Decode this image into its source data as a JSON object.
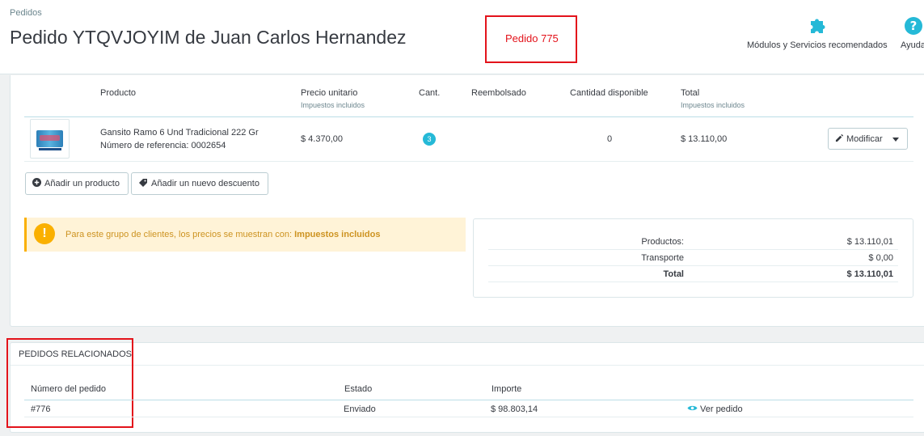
{
  "header": {
    "breadcrumb": "Pedidos",
    "title": "Pedido YTQVJOYIM de Juan Carlos Hernandez",
    "annotation": "Pedido 775",
    "actions": [
      {
        "label": "Módulos y Servicios recomendados",
        "icon": "puzzle-icon"
      },
      {
        "label": "Ayuda",
        "icon": "help-icon"
      }
    ]
  },
  "products_table": {
    "columns": [
      {
        "label": "Producto",
        "sub": ""
      },
      {
        "label": "Precio unitario",
        "sub": "Impuestos incluidos"
      },
      {
        "label": "Cant.",
        "sub": ""
      },
      {
        "label": "Reembolsado",
        "sub": ""
      },
      {
        "label": "Cantidad disponible",
        "sub": ""
      },
      {
        "label": "Total",
        "sub": "Impuestos incluidos"
      }
    ],
    "rows": [
      {
        "name": "Gansito Ramo 6 Und Tradicional 222 Gr",
        "reference": "Número de referencia: 0002654",
        "unit_price": "$ 4.370,00",
        "quantity": "3",
        "refunded": "",
        "available": "0",
        "total": "$ 13.110,00",
        "edit_label": "Modificar"
      }
    ]
  },
  "buttons": {
    "add_product": "Añadir un producto",
    "add_discount": "Añadir un nuevo descuento"
  },
  "alert": {
    "text": "Para este grupo de clientes, los precios se muestran con: ",
    "strong": "Impuestos incluidos"
  },
  "totals": [
    {
      "label": "Productos:",
      "value": "$ 13.110,01"
    },
    {
      "label": "Transporte",
      "value": "$ 0,00"
    },
    {
      "label": "Total",
      "value": "$ 13.110,01"
    }
  ],
  "related": {
    "title": "PEDIDOS RELACIONADOS",
    "columns": [
      "Número del pedido",
      "Estado",
      "Importe"
    ],
    "rows": [
      {
        "number": "#776",
        "status": "Enviado",
        "amount": "$ 98.803,14",
        "action": "Ver pedido"
      }
    ]
  },
  "colors": {
    "accent": "#25b9d7",
    "annotation": "#e3131b",
    "warning": "#fab000"
  }
}
